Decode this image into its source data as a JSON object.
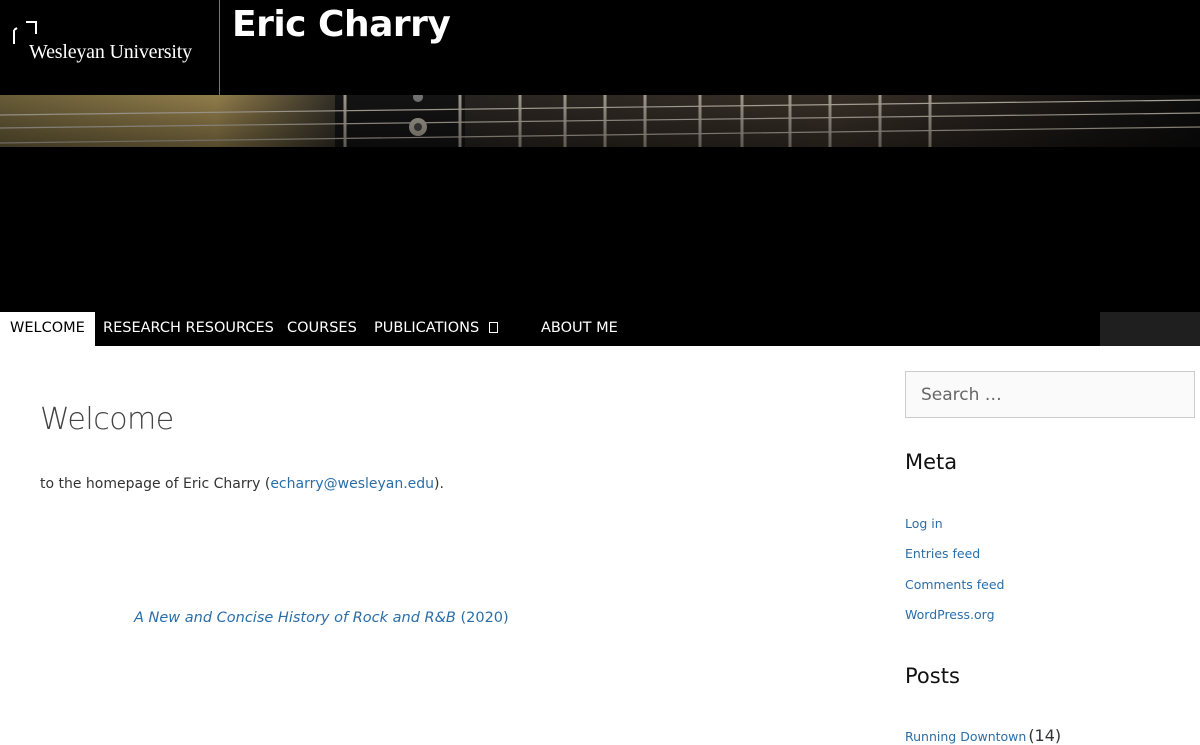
{
  "header": {
    "university": "Wesleyan University",
    "site_title": "Eric Charry"
  },
  "nav": {
    "items": [
      {
        "label": "WELCOME",
        "active": true
      },
      {
        "label": "RESEARCH RESOURCES"
      },
      {
        "label": "COURSES"
      },
      {
        "label": "PUBLICATIONS",
        "has_submenu": true
      },
      {
        "label": "ABOUT ME"
      }
    ]
  },
  "main": {
    "title": "Welcome",
    "intro_prefix": "to the homepage of Eric Charry (",
    "email": "echarry@wesleyan.edu",
    "intro_suffix": ").",
    "book_title": "A New and Concise History of Rock and R&B",
    "book_year": " (2020)"
  },
  "sidebar": {
    "search_placeholder": "Search …",
    "meta": {
      "title": "Meta",
      "links": [
        "Log in",
        "Entries feed",
        "Comments feed",
        "WordPress.org"
      ]
    },
    "posts": {
      "title": "Posts",
      "items": [
        {
          "label": "Running Downtown",
          "count": "(14)"
        }
      ]
    }
  },
  "colors": {
    "link": "#2a6ea8",
    "header_bg": "#000000"
  }
}
